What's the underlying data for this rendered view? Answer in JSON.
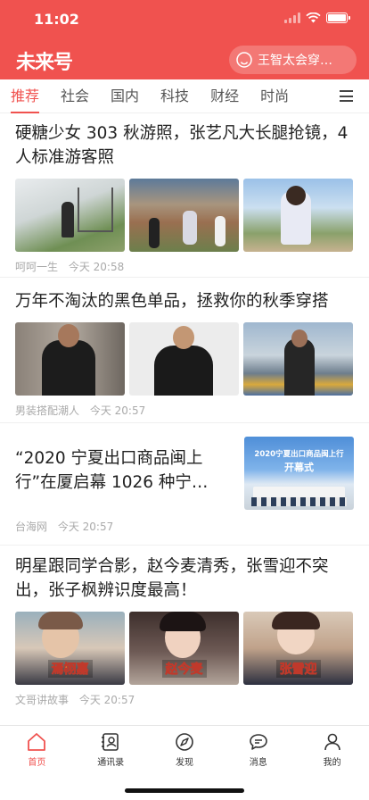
{
  "status": {
    "time": "11:02"
  },
  "header": {
    "logo": "未来号",
    "search_placeholder": "王智太会穿…"
  },
  "tabs": [
    {
      "label": "推荐",
      "active": true
    },
    {
      "label": "社会"
    },
    {
      "label": "国内"
    },
    {
      "label": "科技"
    },
    {
      "label": "财经"
    },
    {
      "label": "时尚"
    }
  ],
  "articles": [
    {
      "title": "硬糖少女 303 秋游照，张艺凡大长腿抢镜，4人标准游客照",
      "source": "呵呵一生",
      "time": "今天 20:58"
    },
    {
      "title": "万年不淘汰的黑色单品，拯救你的秋季穿搭",
      "source": "男装搭配潮人",
      "time": "今天 20:57"
    },
    {
      "title": "“2020 宁夏出口商品闽上行”在厦启幕 1026 种宁…",
      "source": "台海网",
      "time": "今天 20:57",
      "image_caption": "2020宁夏出口商品闽上行",
      "image_sub": "开幕式"
    },
    {
      "title": "明星跟同学合影，赵今麦清秀，张雪迎不突出，张子枫辨识度最高！",
      "source": "文哥讲故事",
      "time": "今天 20:57",
      "image_labels": [
        "焉栩嘉",
        "赵今麦",
        "张雪迎"
      ]
    }
  ],
  "bottom_nav": [
    {
      "label": "首页",
      "icon": "home-icon",
      "active": true
    },
    {
      "label": "通讯录",
      "icon": "contacts-icon"
    },
    {
      "label": "发现",
      "icon": "compass-icon"
    },
    {
      "label": "消息",
      "icon": "message-icon"
    },
    {
      "label": "我的",
      "icon": "person-icon"
    }
  ],
  "colors": {
    "accent": "#f0524f"
  }
}
